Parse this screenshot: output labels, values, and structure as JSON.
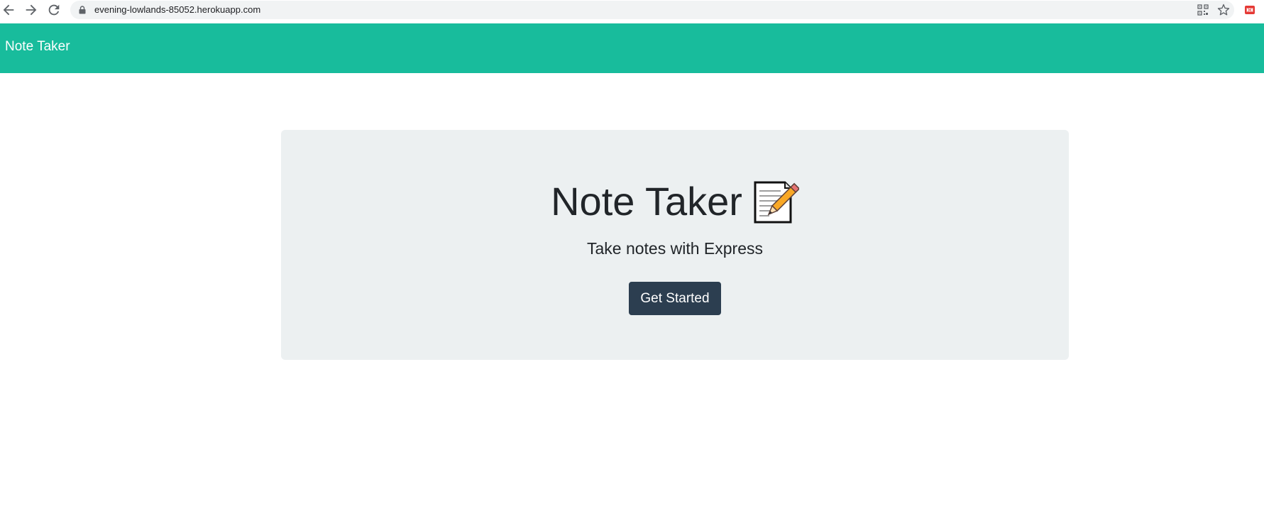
{
  "browser": {
    "url": "evening-lowlands-85052.herokuapp.com",
    "icons": [
      "back-arrow-icon",
      "forward-arrow-icon",
      "reload-icon",
      "lock-icon",
      "qr-code-icon",
      "star-icon",
      "extension-icon"
    ]
  },
  "navbar": {
    "brand": "Note Taker",
    "color": "#18bc9c"
  },
  "hero": {
    "title": "Note Taker",
    "icon": "memo-icon",
    "subtitle": "Take notes with Express",
    "button_label": "Get Started",
    "background": "#ecf0f1",
    "button_color": "#2c3e50"
  }
}
